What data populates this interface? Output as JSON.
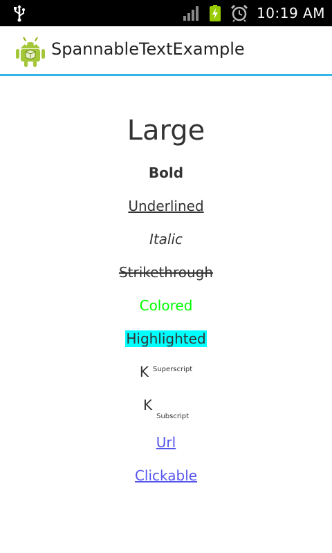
{
  "status_bar": {
    "time": "10:19 AM",
    "icons": [
      "usb-icon",
      "signal-icon",
      "battery-charging-icon",
      "alarm-icon"
    ]
  },
  "action_bar": {
    "title": "SpannableTextExample",
    "icon": "android-app-icon",
    "divider_color": "#33b5e5"
  },
  "spans": {
    "large": "Large",
    "bold": "Bold",
    "underlined": "Underlined",
    "italic": "Italic",
    "strikethrough": "Strikethrough",
    "colored": "Colored",
    "highlighted": "Highlighted",
    "superscript_base": "K",
    "superscript": "Superscript",
    "subscript_base": "K",
    "subscript": "Subscript",
    "url": "Url",
    "clickable": "Clickable"
  },
  "colors": {
    "text": "#333333",
    "colored": "#00ff00",
    "highlight_bg": "#00ffff",
    "link": "#5555ee"
  }
}
